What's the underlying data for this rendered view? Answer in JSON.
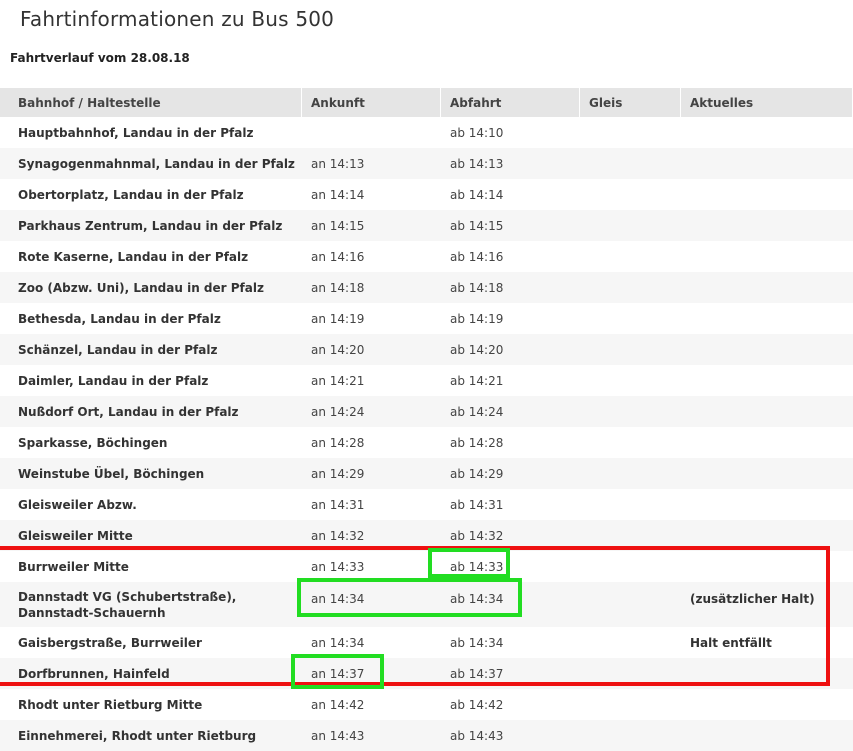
{
  "page": {
    "title": "Fahrtinformationen zu Bus 500",
    "subtitle": "Fahrtverlauf vom 28.08.18"
  },
  "table": {
    "headers": {
      "stop": "Bahnhof / Haltestelle",
      "arrival": "Ankunft",
      "departure": "Abfahrt",
      "platform": "Gleis",
      "news": "Aktuelles"
    },
    "rows": [
      {
        "stop": "Hauptbahnhof, Landau in der Pfalz",
        "arrival": "",
        "departure": "ab 14:10",
        "platform": "",
        "news": ""
      },
      {
        "stop": "Synagogenmahnmal, Landau in der Pfalz",
        "arrival": "an 14:13",
        "departure": "ab 14:13",
        "platform": "",
        "news": ""
      },
      {
        "stop": "Obertorplatz, Landau in der Pfalz",
        "arrival": "an 14:14",
        "departure": "ab 14:14",
        "platform": "",
        "news": ""
      },
      {
        "stop": "Parkhaus Zentrum, Landau in der Pfalz",
        "arrival": "an 14:15",
        "departure": "ab 14:15",
        "platform": "",
        "news": ""
      },
      {
        "stop": "Rote Kaserne, Landau in der Pfalz",
        "arrival": "an 14:16",
        "departure": "ab 14:16",
        "platform": "",
        "news": ""
      },
      {
        "stop": "Zoo (Abzw. Uni), Landau in der Pfalz",
        "arrival": "an 14:18",
        "departure": "ab 14:18",
        "platform": "",
        "news": ""
      },
      {
        "stop": "Bethesda, Landau in der Pfalz",
        "arrival": "an 14:19",
        "departure": "ab 14:19",
        "platform": "",
        "news": ""
      },
      {
        "stop": "Schänzel, Landau in der Pfalz",
        "arrival": "an 14:20",
        "departure": "ab 14:20",
        "platform": "",
        "news": ""
      },
      {
        "stop": "Daimler, Landau in der Pfalz",
        "arrival": "an 14:21",
        "departure": "ab 14:21",
        "platform": "",
        "news": ""
      },
      {
        "stop": "Nußdorf Ort, Landau in der Pfalz",
        "arrival": "an 14:24",
        "departure": "ab 14:24",
        "platform": "",
        "news": ""
      },
      {
        "stop": "Sparkasse, Böchingen",
        "arrival": "an 14:28",
        "departure": "ab 14:28",
        "platform": "",
        "news": ""
      },
      {
        "stop": "Weinstube Übel, Böchingen",
        "arrival": "an 14:29",
        "departure": "ab 14:29",
        "platform": "",
        "news": ""
      },
      {
        "stop": "Gleisweiler Abzw.",
        "arrival": "an 14:31",
        "departure": "ab 14:31",
        "platform": "",
        "news": ""
      },
      {
        "stop": "Gleisweiler Mitte",
        "arrival": "an 14:32",
        "departure": "ab 14:32",
        "platform": "",
        "news": ""
      },
      {
        "stop": "Burrweiler Mitte",
        "arrival": "an 14:33",
        "departure": "ab 14:33",
        "platform": "",
        "news": ""
      },
      {
        "stop": "Dannstadt VG (Schubertstraße), Dannstadt-Schauernh",
        "arrival": "an 14:34",
        "departure": "ab 14:34",
        "platform": "",
        "news": "(zusätzlicher Halt)"
      },
      {
        "stop": "Gaisbergstraße, Burrweiler",
        "arrival": "an 14:34",
        "departure": "ab 14:34",
        "platform": "",
        "news": "Halt entfällt"
      },
      {
        "stop": "Dorfbrunnen, Hainfeld",
        "arrival": "an 14:37",
        "departure": "ab 14:37",
        "platform": "",
        "news": ""
      },
      {
        "stop": "Rhodt unter Rietburg Mitte",
        "arrival": "an 14:42",
        "departure": "ab 14:42",
        "platform": "",
        "news": ""
      },
      {
        "stop": "Einnehmerei, Rhodt unter Rietburg",
        "arrival": "an 14:43",
        "departure": "ab 14:43",
        "platform": "",
        "news": ""
      }
    ]
  },
  "annotations": {
    "red_color": "#ee1111",
    "green_color": "#22dd22"
  }
}
